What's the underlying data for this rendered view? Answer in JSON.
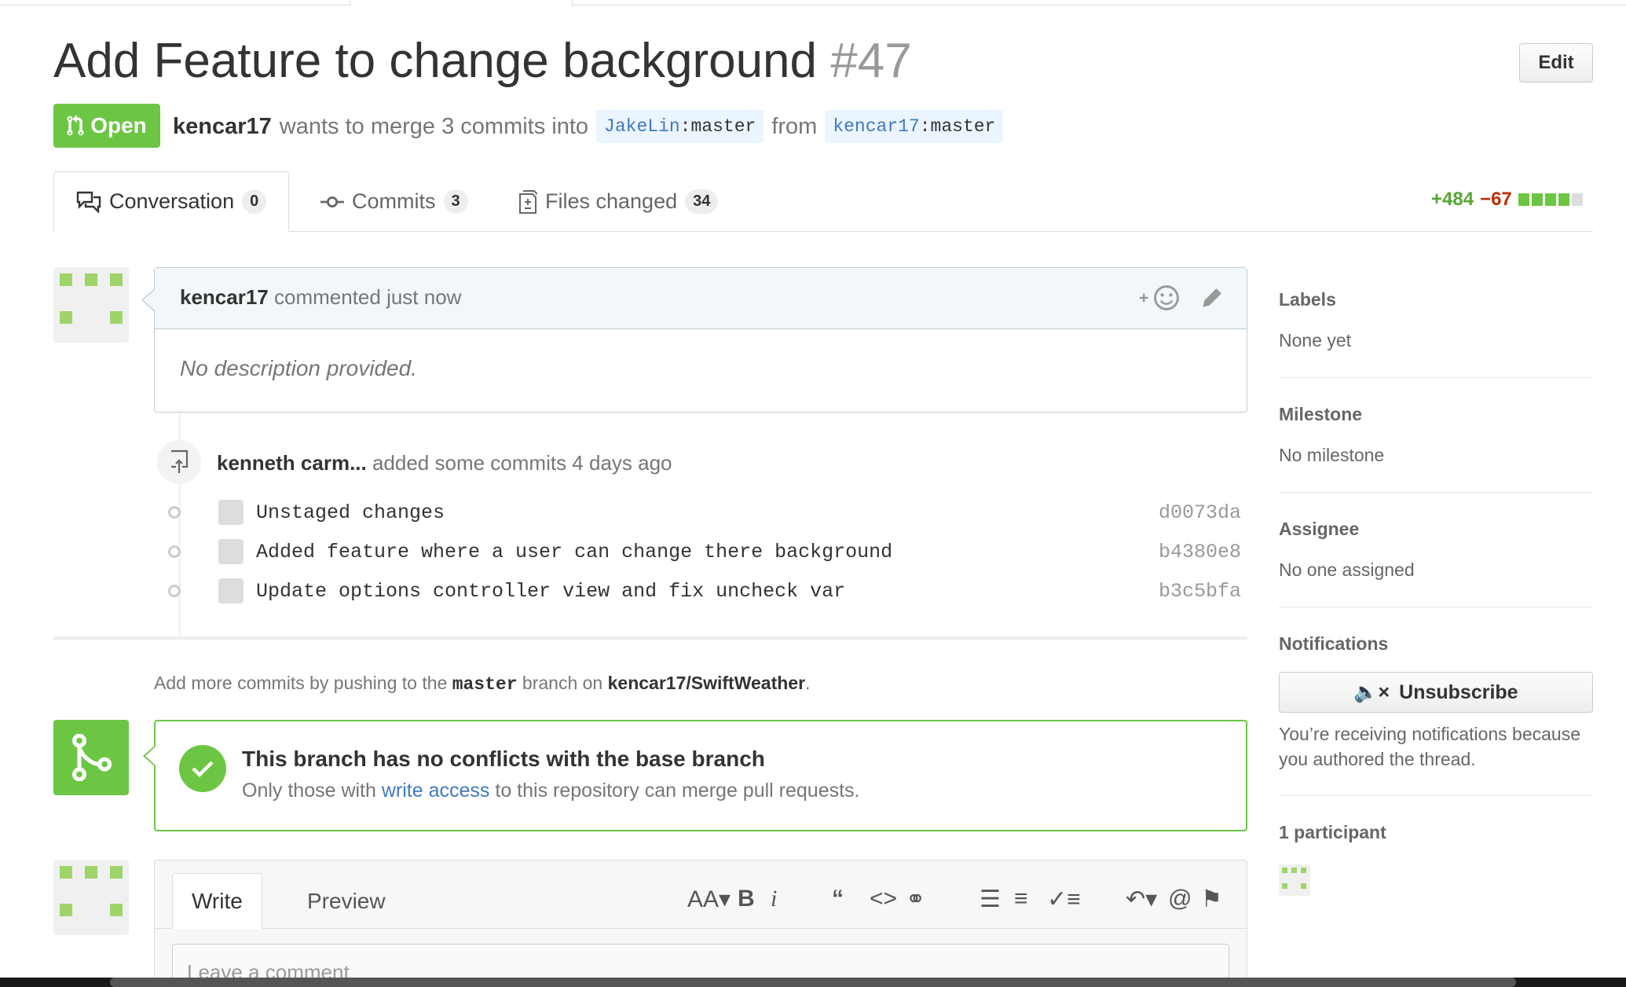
{
  "header": {
    "title": "Add Feature to change background",
    "number": "#47",
    "edit_label": "Edit",
    "state_label": "Open",
    "author": "kencar17",
    "merge_text": "wants to merge 3 commits into",
    "base_owner": "JakeLin",
    "base_branch": "master",
    "from_text": "from",
    "head_owner": "kencar17",
    "head_branch": "master"
  },
  "tabs": [
    {
      "label": "Conversation",
      "count": "0"
    },
    {
      "label": "Commits",
      "count": "3"
    },
    {
      "label": "Files changed",
      "count": "34"
    }
  ],
  "diffstat": {
    "additions": "+484",
    "deletions": "−67",
    "blocks": [
      "#6cc644",
      "#6cc644",
      "#6cc644",
      "#6cc644",
      "#ddd"
    ]
  },
  "comment": {
    "author": "kencar17",
    "action": "commented just now",
    "body": "No description provided."
  },
  "push_event": {
    "actor": "kenneth carm...",
    "text": "added some commits 4 days ago"
  },
  "commits": [
    {
      "message": "Unstaged changes",
      "sha": "d0073da"
    },
    {
      "message": "Added feature where a user can change there background",
      "sha": "b4380e8"
    },
    {
      "message": "Update options controller view and fix uncheck var",
      "sha": "b3c5bfa"
    }
  ],
  "hint": {
    "prefix": "Add more commits by pushing to the",
    "branch": "master",
    "middle": "branch on",
    "repo": "kencar17/SwiftWeather",
    "suffix": "."
  },
  "merge": {
    "title": "This branch has no conflicts with the base branch",
    "sub_prefix": "Only those with",
    "link": "write access",
    "sub_suffix": "to this repository can merge pull requests."
  },
  "composer": {
    "write_tab": "Write",
    "preview_tab": "Preview",
    "placeholder": "Leave a comment"
  },
  "sidebar": {
    "labels_heading": "Labels",
    "labels_value": "None yet",
    "milestone_heading": "Milestone",
    "milestone_value": "No milestone",
    "assignee_heading": "Assignee",
    "assignee_value": "No one assigned",
    "notifications_heading": "Notifications",
    "unsubscribe_label": "Unsubscribe",
    "notifications_text": "You’re receiving notifications because you authored the thread.",
    "participants_heading": "1 participant"
  }
}
